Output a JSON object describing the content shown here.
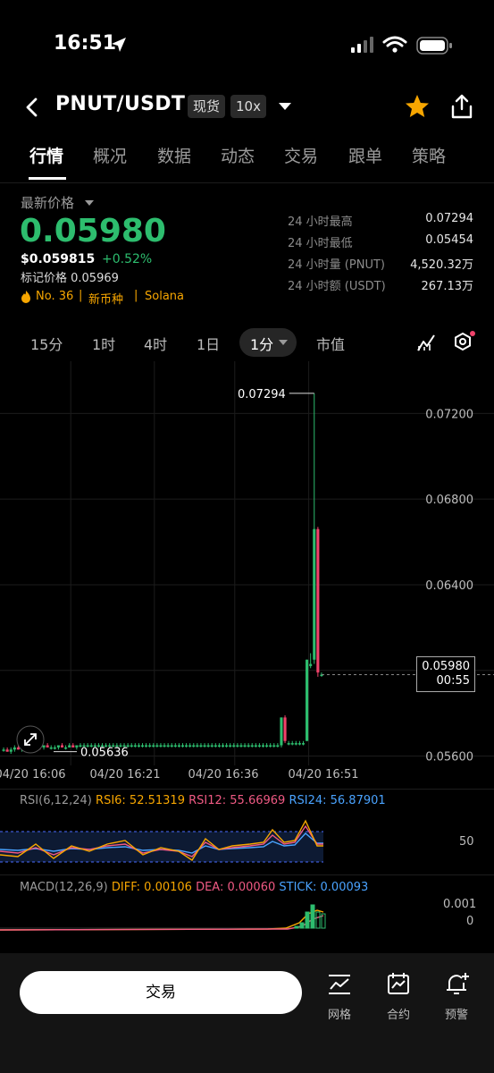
{
  "status_bar": {
    "time": "16:51"
  },
  "header": {
    "title": "PNUT/USDT",
    "market_badge": "现货",
    "leverage_badge": "10x"
  },
  "tabs": [
    "行情",
    "概况",
    "数据",
    "动态",
    "交易",
    "跟单",
    "策略"
  ],
  "price_block": {
    "label": "最新价格",
    "last_price": "0.05980",
    "usd_price": "$0.059815",
    "change": "+0.52%",
    "mark_price": "标记价格 0.05969",
    "rank": "No. 36",
    "tag_new": "新币种",
    "tag_chain": "Solana"
  },
  "stats": [
    {
      "label": "24 小时最高",
      "value": "0.07294"
    },
    {
      "label": "24 小时最低",
      "value": "0.05454"
    },
    {
      "label": "24 小时量 (PNUT)",
      "value": "4,520.32万"
    },
    {
      "label": "24 小时额 (USDT)",
      "value": "267.13万"
    }
  ],
  "timeframes": [
    "15分",
    "1时",
    "4时",
    "1日",
    "1分",
    "市值"
  ],
  "chart_data": {
    "type": "candlestick",
    "interval": "1分",
    "y_axis_ticks": [
      "0.07200",
      "0.06800",
      "0.06400",
      "0.06000",
      "0.05600"
    ],
    "x_axis_ticks": [
      "04/20 16:06",
      "04/20 16:21",
      "04/20 16:36",
      "04/20 16:51"
    ],
    "high_marker": "0.07294",
    "low_marker": "0.05636",
    "current_price": "0.05980",
    "countdown": "00:55",
    "candles": [
      {
        "o": 0.0563,
        "h": 0.0564,
        "l": 0.0562,
        "c": 0.0563
      },
      {
        "o": 0.0563,
        "h": 0.0564,
        "l": 0.0562,
        "c": 0.0562
      },
      {
        "o": 0.0562,
        "h": 0.0564,
        "l": 0.0561,
        "c": 0.0563
      },
      {
        "o": 0.0563,
        "h": 0.0565,
        "l": 0.0562,
        "c": 0.0564
      },
      {
        "o": 0.0564,
        "h": 0.0565,
        "l": 0.0563,
        "c": 0.0563
      },
      {
        "o": 0.0563,
        "h": 0.0564,
        "l": 0.0562,
        "c": 0.0564
      },
      {
        "o": 0.0564,
        "h": 0.0565,
        "l": 0.0563,
        "c": 0.0563
      },
      {
        "o": 0.0563,
        "h": 0.0564,
        "l": 0.0562,
        "c": 0.0563
      },
      {
        "o": 0.0563,
        "h": 0.0565,
        "l": 0.0563,
        "c": 0.0564
      },
      {
        "o": 0.0564,
        "h": 0.0565,
        "l": 0.0563,
        "c": 0.0565
      },
      {
        "o": 0.0565,
        "h": 0.0565,
        "l": 0.0563,
        "c": 0.0564
      },
      {
        "o": 0.0564,
        "h": 0.0565,
        "l": 0.0563,
        "c": 0.0565
      },
      {
        "o": 0.0565,
        "h": 0.0566,
        "l": 0.0564,
        "c": 0.0564
      },
      {
        "o": 0.0564,
        "h": 0.0565,
        "l": 0.0563,
        "c": 0.0564
      },
      {
        "o": 0.0564,
        "h": 0.0565,
        "l": 0.0563,
        "c": 0.0564
      },
      {
        "o": 0.0564,
        "h": 0.0565,
        "l": 0.0563,
        "c": 0.0565
      },
      {
        "o": 0.0565,
        "h": 0.0566,
        "l": 0.0564,
        "c": 0.0564
      },
      {
        "o": 0.0564,
        "h": 0.0565,
        "l": 0.0563,
        "c": 0.0564
      },
      {
        "o": 0.0564,
        "h": 0.0566,
        "l": 0.0564,
        "c": 0.0565
      },
      {
        "o": 0.0565,
        "h": 0.0566,
        "l": 0.0564,
        "c": 0.0564
      },
      {
        "o": 0.0564,
        "h": 0.0565,
        "l": 0.0563,
        "c": 0.0565
      },
      {
        "o": 0.0565,
        "h": 0.0566,
        "l": 0.0564,
        "c": 0.0565
      },
      {
        "o": 0.0565,
        "h": 0.0566,
        "l": 0.0564,
        "c": 0.0565
      },
      {
        "o": 0.0565,
        "h": 0.0566,
        "l": 0.0564,
        "c": 0.0565
      },
      {
        "o": 0.0565,
        "h": 0.0566,
        "l": 0.0564,
        "c": 0.0565
      },
      {
        "o": 0.0565,
        "h": 0.0566,
        "l": 0.0564,
        "c": 0.0565
      },
      {
        "o": 0.0565,
        "h": 0.0566,
        "l": 0.0564,
        "c": 0.0565
      },
      {
        "o": 0.0565,
        "h": 0.0566,
        "l": 0.0564,
        "c": 0.0565
      },
      {
        "o": 0.0565,
        "h": 0.0566,
        "l": 0.0564,
        "c": 0.0565
      },
      {
        "o": 0.0565,
        "h": 0.0566,
        "l": 0.0564,
        "c": 0.0565
      },
      {
        "o": 0.0565,
        "h": 0.0566,
        "l": 0.0564,
        "c": 0.0565
      },
      {
        "o": 0.0565,
        "h": 0.0566,
        "l": 0.0564,
        "c": 0.0565
      },
      {
        "o": 0.0565,
        "h": 0.0566,
        "l": 0.0564,
        "c": 0.0565
      },
      {
        "o": 0.0565,
        "h": 0.0566,
        "l": 0.0564,
        "c": 0.0565
      },
      {
        "o": 0.0565,
        "h": 0.0566,
        "l": 0.0564,
        "c": 0.0565
      },
      {
        "o": 0.0565,
        "h": 0.0566,
        "l": 0.0564,
        "c": 0.0565
      },
      {
        "o": 0.0565,
        "h": 0.0566,
        "l": 0.0564,
        "c": 0.0565
      },
      {
        "o": 0.0565,
        "h": 0.0566,
        "l": 0.0564,
        "c": 0.0565
      },
      {
        "o": 0.0565,
        "h": 0.0566,
        "l": 0.0564,
        "c": 0.0565
      },
      {
        "o": 0.0565,
        "h": 0.0566,
        "l": 0.0564,
        "c": 0.0565
      },
      {
        "o": 0.0565,
        "h": 0.0566,
        "l": 0.0564,
        "c": 0.0565
      },
      {
        "o": 0.0565,
        "h": 0.0566,
        "l": 0.0564,
        "c": 0.0565
      },
      {
        "o": 0.0565,
        "h": 0.0566,
        "l": 0.0564,
        "c": 0.0565
      },
      {
        "o": 0.0565,
        "h": 0.0566,
        "l": 0.0564,
        "c": 0.0565
      },
      {
        "o": 0.0565,
        "h": 0.0566,
        "l": 0.0564,
        "c": 0.0565
      },
      {
        "o": 0.0565,
        "h": 0.0566,
        "l": 0.0564,
        "c": 0.0565
      },
      {
        "o": 0.0565,
        "h": 0.0566,
        "l": 0.0564,
        "c": 0.0565
      },
      {
        "o": 0.0565,
        "h": 0.0566,
        "l": 0.0564,
        "c": 0.0565
      },
      {
        "o": 0.0565,
        "h": 0.0566,
        "l": 0.0564,
        "c": 0.0565
      },
      {
        "o": 0.0565,
        "h": 0.0566,
        "l": 0.0564,
        "c": 0.0565
      },
      {
        "o": 0.0565,
        "h": 0.0566,
        "l": 0.0564,
        "c": 0.0565
      },
      {
        "o": 0.0565,
        "h": 0.0566,
        "l": 0.0564,
        "c": 0.0565
      },
      {
        "o": 0.0565,
        "h": 0.0566,
        "l": 0.0564,
        "c": 0.0565
      },
      {
        "o": 0.0565,
        "h": 0.0566,
        "l": 0.0564,
        "c": 0.0565
      },
      {
        "o": 0.0565,
        "h": 0.0566,
        "l": 0.0564,
        "c": 0.0565
      },
      {
        "o": 0.0565,
        "h": 0.0566,
        "l": 0.0564,
        "c": 0.0565
      },
      {
        "o": 0.0565,
        "h": 0.0566,
        "l": 0.0564,
        "c": 0.0565
      },
      {
        "o": 0.0565,
        "h": 0.0566,
        "l": 0.0564,
        "c": 0.0565
      },
      {
        "o": 0.0565,
        "h": 0.0566,
        "l": 0.0564,
        "c": 0.0565
      },
      {
        "o": 0.0565,
        "h": 0.0566,
        "l": 0.0564,
        "c": 0.0565
      },
      {
        "o": 0.0565,
        "h": 0.0566,
        "l": 0.0564,
        "c": 0.0565
      },
      {
        "o": 0.0565,
        "h": 0.0566,
        "l": 0.0564,
        "c": 0.0565
      },
      {
        "o": 0.0565,
        "h": 0.0566,
        "l": 0.0564,
        "c": 0.0565
      },
      {
        "o": 0.0565,
        "h": 0.0566,
        "l": 0.0564,
        "c": 0.0565
      },
      {
        "o": 0.0565,
        "h": 0.0566,
        "l": 0.0564,
        "c": 0.0565
      },
      {
        "o": 0.0565,
        "h": 0.0566,
        "l": 0.0564,
        "c": 0.0565
      },
      {
        "o": 0.0565,
        "h": 0.0566,
        "l": 0.0564,
        "c": 0.0565
      },
      {
        "o": 0.0565,
        "h": 0.0566,
        "l": 0.0564,
        "c": 0.0565
      },
      {
        "o": 0.0565,
        "h": 0.0566,
        "l": 0.0564,
        "c": 0.0565
      },
      {
        "o": 0.0565,
        "h": 0.0566,
        "l": 0.0564,
        "c": 0.0565
      },
      {
        "o": 0.0565,
        "h": 0.0566,
        "l": 0.0564,
        "c": 0.0565
      },
      {
        "o": 0.0565,
        "h": 0.0566,
        "l": 0.0564,
        "c": 0.0565
      },
      {
        "o": 0.0565,
        "h": 0.0566,
        "l": 0.0564,
        "c": 0.0565
      },
      {
        "o": 0.0565,
        "h": 0.0566,
        "l": 0.0564,
        "c": 0.0565
      },
      {
        "o": 0.0565,
        "h": 0.0566,
        "l": 0.0564,
        "c": 0.0565
      },
      {
        "o": 0.0565,
        "h": 0.0566,
        "l": 0.0564,
        "c": 0.0565
      },
      {
        "o": 0.0565,
        "h": 0.0578,
        "l": 0.0564,
        "c": 0.0578
      },
      {
        "o": 0.0578,
        "h": 0.0579,
        "l": 0.0566,
        "c": 0.0567
      },
      {
        "o": 0.0566,
        "h": 0.0567,
        "l": 0.0565,
        "c": 0.0566
      },
      {
        "o": 0.0566,
        "h": 0.0567,
        "l": 0.0565,
        "c": 0.0566
      },
      {
        "o": 0.0566,
        "h": 0.0567,
        "l": 0.0565,
        "c": 0.0566
      },
      {
        "o": 0.0566,
        "h": 0.0567,
        "l": 0.0565,
        "c": 0.0566
      },
      {
        "o": 0.0566,
        "h": 0.0567,
        "l": 0.0565,
        "c": 0.0566
      },
      {
        "o": 0.0567,
        "h": 0.0605,
        "l": 0.0567,
        "c": 0.0605
      },
      {
        "o": 0.0602,
        "h": 0.0608,
        "l": 0.0601,
        "c": 0.0603
      },
      {
        "o": 0.0605,
        "h": 0.07294,
        "l": 0.0603,
        "c": 0.0666
      },
      {
        "o": 0.0666,
        "h": 0.0667,
        "l": 0.0597,
        "c": 0.0599
      },
      {
        "o": 0.0598,
        "h": 0.0599,
        "l": 0.0597,
        "c": 0.0598
      }
    ],
    "rsi": {
      "label": "RSI(6,12,24)",
      "rsi6": "RSI6: 52.51319",
      "rsi12": "RSI12: 55.66969",
      "rsi24": "RSI24: 56.87901",
      "level_label": "50"
    },
    "macd": {
      "label": "MACD(12,26,9)",
      "diff": "DIFF: 0.00106",
      "dea": "DEA: 0.00060",
      "stick": "STICK: 0.00093",
      "tick_top": "0.001",
      "tick_zero": "0"
    },
    "colors": {
      "up": "#2dbd6e",
      "down": "#f0426a",
      "rsi6": "#f7a600",
      "rsi12": "#f05a84",
      "rsi24": "#4aa3ff"
    }
  },
  "bottom": {
    "trade_button": "交易",
    "grid": "网格",
    "contract": "合约",
    "alert": "预警"
  }
}
